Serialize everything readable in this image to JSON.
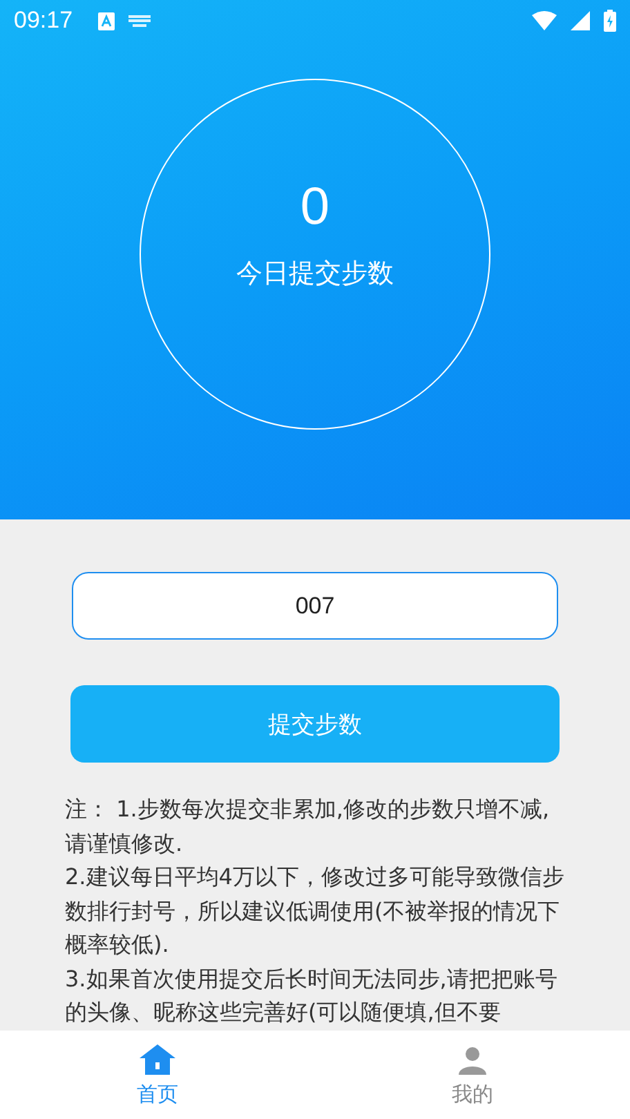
{
  "status_bar": {
    "time": "09:17"
  },
  "today": {
    "value": "0",
    "label": "今日提交步数"
  },
  "steps_field": {
    "value": "007"
  },
  "submit_button": {
    "label": "提交步数"
  },
  "notes": [
    "注： 1.步数每次提交非累加,修改的步数只增不减,请谨慎修改.",
    "2.建议每日平均4万以下，修改过多可能导致微信步数排行封号，所以建议低调使用(不被举报的情况下概率较低).",
    "3.如果首次使用提交后长时间无法同步,请把把账号的头像、昵称这些完善好(可以随便填,但不要"
  ],
  "bottom_nav": [
    {
      "label": "首页",
      "kind": "home",
      "selected": true
    },
    {
      "label": "我的",
      "kind": "profile",
      "selected": false
    }
  ]
}
